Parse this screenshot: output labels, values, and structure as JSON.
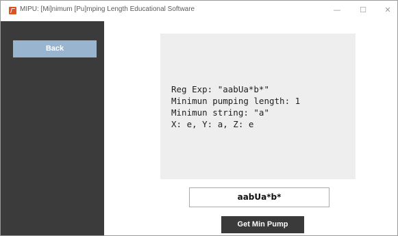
{
  "window": {
    "title": "MIPU: [Mi]nimum [Pu]mping Length Educational Software",
    "minimize_symbol": "—",
    "maximize_symbol": "☐",
    "close_symbol": "✕"
  },
  "sidebar": {
    "back_label": "Back"
  },
  "output": {
    "lines": [
      "Reg Exp: \"aabUa*b*\"",
      "Minimun pumping length: 1",
      "Minimun string: \"a\"",
      "X: e, Y: a, Z: e"
    ]
  },
  "regex_input": {
    "value": "aabUa*b*"
  },
  "actions": {
    "get_min_pump_label": "Get Min Pump"
  },
  "colors": {
    "sidebar": "#3b3b3b",
    "back_button": "#99b4cf",
    "output_panel": "#eeeeee",
    "action_button": "#3a3a3a"
  },
  "icons": {
    "app": "app-logo-icon"
  }
}
